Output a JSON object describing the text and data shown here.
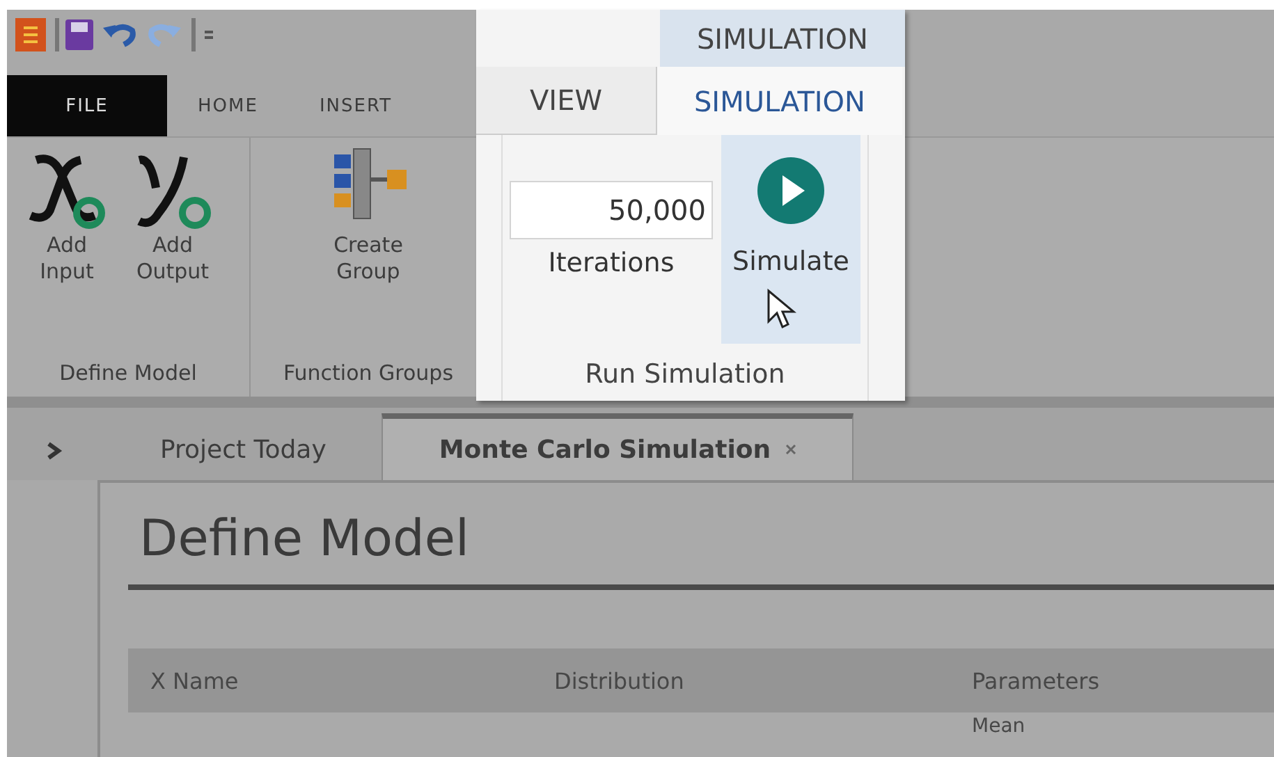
{
  "ribbon_tabs": [
    {
      "label": "FILE",
      "kind": "file"
    },
    {
      "label": "HOME",
      "kind": "tab"
    },
    {
      "label": "INSERT",
      "kind": "tab"
    }
  ],
  "ribbon_groups": [
    {
      "label": "Define Model",
      "buttons": [
        {
          "label": "Add Input",
          "kind": "x-variable"
        },
        {
          "label": "Add Output",
          "kind": "y-variable"
        }
      ]
    },
    {
      "label": "Function Groups",
      "buttons": [
        {
          "label": "Create Group",
          "kind": "group"
        }
      ]
    }
  ],
  "callout": {
    "context_tab": "SIMULATION",
    "tabs": [
      {
        "label": "VIEW",
        "selected": false
      },
      {
        "label": "SIMULATION",
        "selected": true
      }
    ],
    "iterations": {
      "value": "50,000",
      "label": "Iterations"
    },
    "simulate_button": "Simulate",
    "group_label": "Run Simulation"
  },
  "document_tabs": [
    {
      "label": "Project Today",
      "selected": false,
      "closable": false
    },
    {
      "label": "Monte Carlo Simulation",
      "selected": true,
      "closable": true
    }
  ],
  "page": {
    "title": "Define Model",
    "table": {
      "columns": [
        "X Name",
        "Distribution",
        "Parameters"
      ],
      "rows": [
        {
          "parameters": "Mean"
        }
      ]
    }
  }
}
